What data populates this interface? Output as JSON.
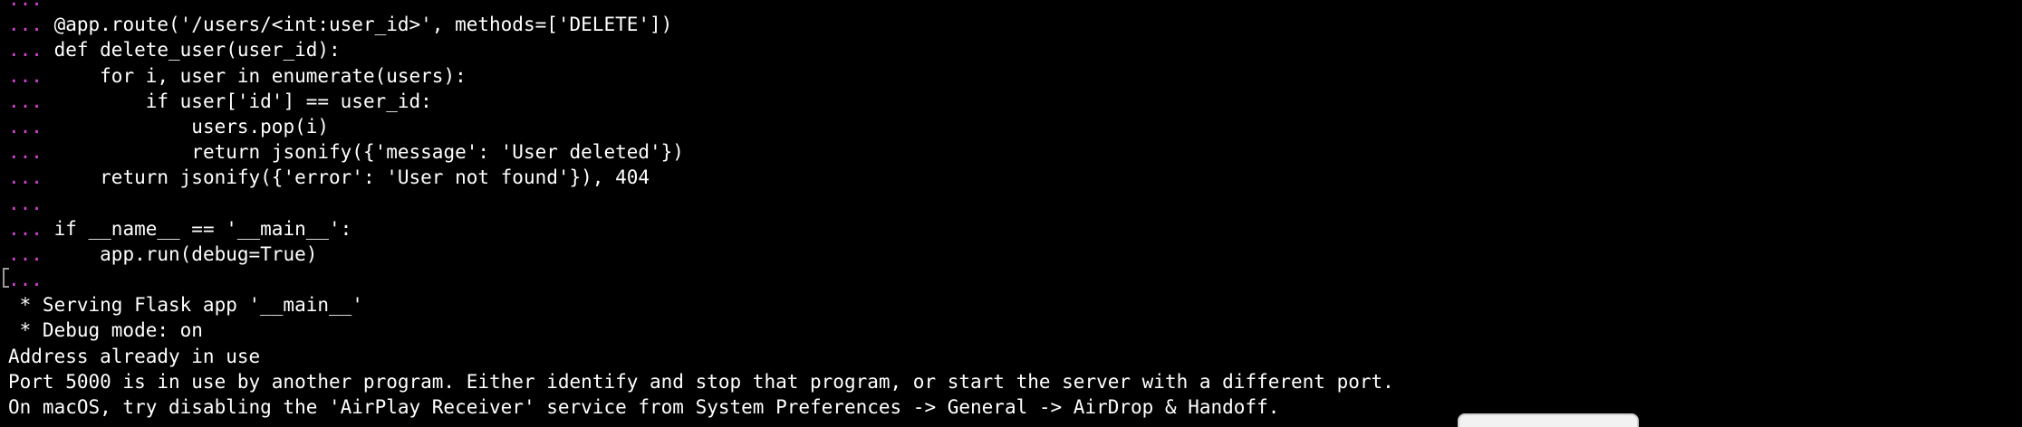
{
  "terminal": {
    "lines": [
      {
        "prompt": "...",
        "text": ""
      },
      {
        "prompt": "...",
        "text": " @app.route('/users/<int:user_id>', methods=['DELETE'])"
      },
      {
        "prompt": "...",
        "text": " def delete_user(user_id):"
      },
      {
        "prompt": "...",
        "text": "     for i, user in enumerate(users):"
      },
      {
        "prompt": "...",
        "text": "         if user['id'] == user_id:"
      },
      {
        "prompt": "...",
        "text": "             users.pop(i)"
      },
      {
        "prompt": "...",
        "text": "             return jsonify({'message': 'User deleted'})"
      },
      {
        "prompt": "...",
        "text": "     return jsonify({'error': 'User not found'}), 404"
      },
      {
        "prompt": "...",
        "text": ""
      },
      {
        "prompt": "...",
        "text": " if __name__ == '__main__':"
      },
      {
        "prompt": "...",
        "text": "     app.run(debug=True)"
      },
      {
        "prompt": "...",
        "text": ""
      },
      {
        "prompt": "",
        "text": " * Serving Flask app '__main__'"
      },
      {
        "prompt": "",
        "text": " * Debug mode: on"
      },
      {
        "prompt": "",
        "text": "Address already in use"
      },
      {
        "prompt": "",
        "text": "Port 5000 is in use by another program. Either identify and stop that program, or start the server with a different port."
      },
      {
        "prompt": "",
        "text": "On macOS, try disabling the 'AirPlay Receiver' service from System Preferences -> General -> AirDrop & Handoff."
      }
    ]
  },
  "colors": {
    "background": "#000000",
    "prompt": "#d642d6",
    "text": "#ffffff"
  }
}
